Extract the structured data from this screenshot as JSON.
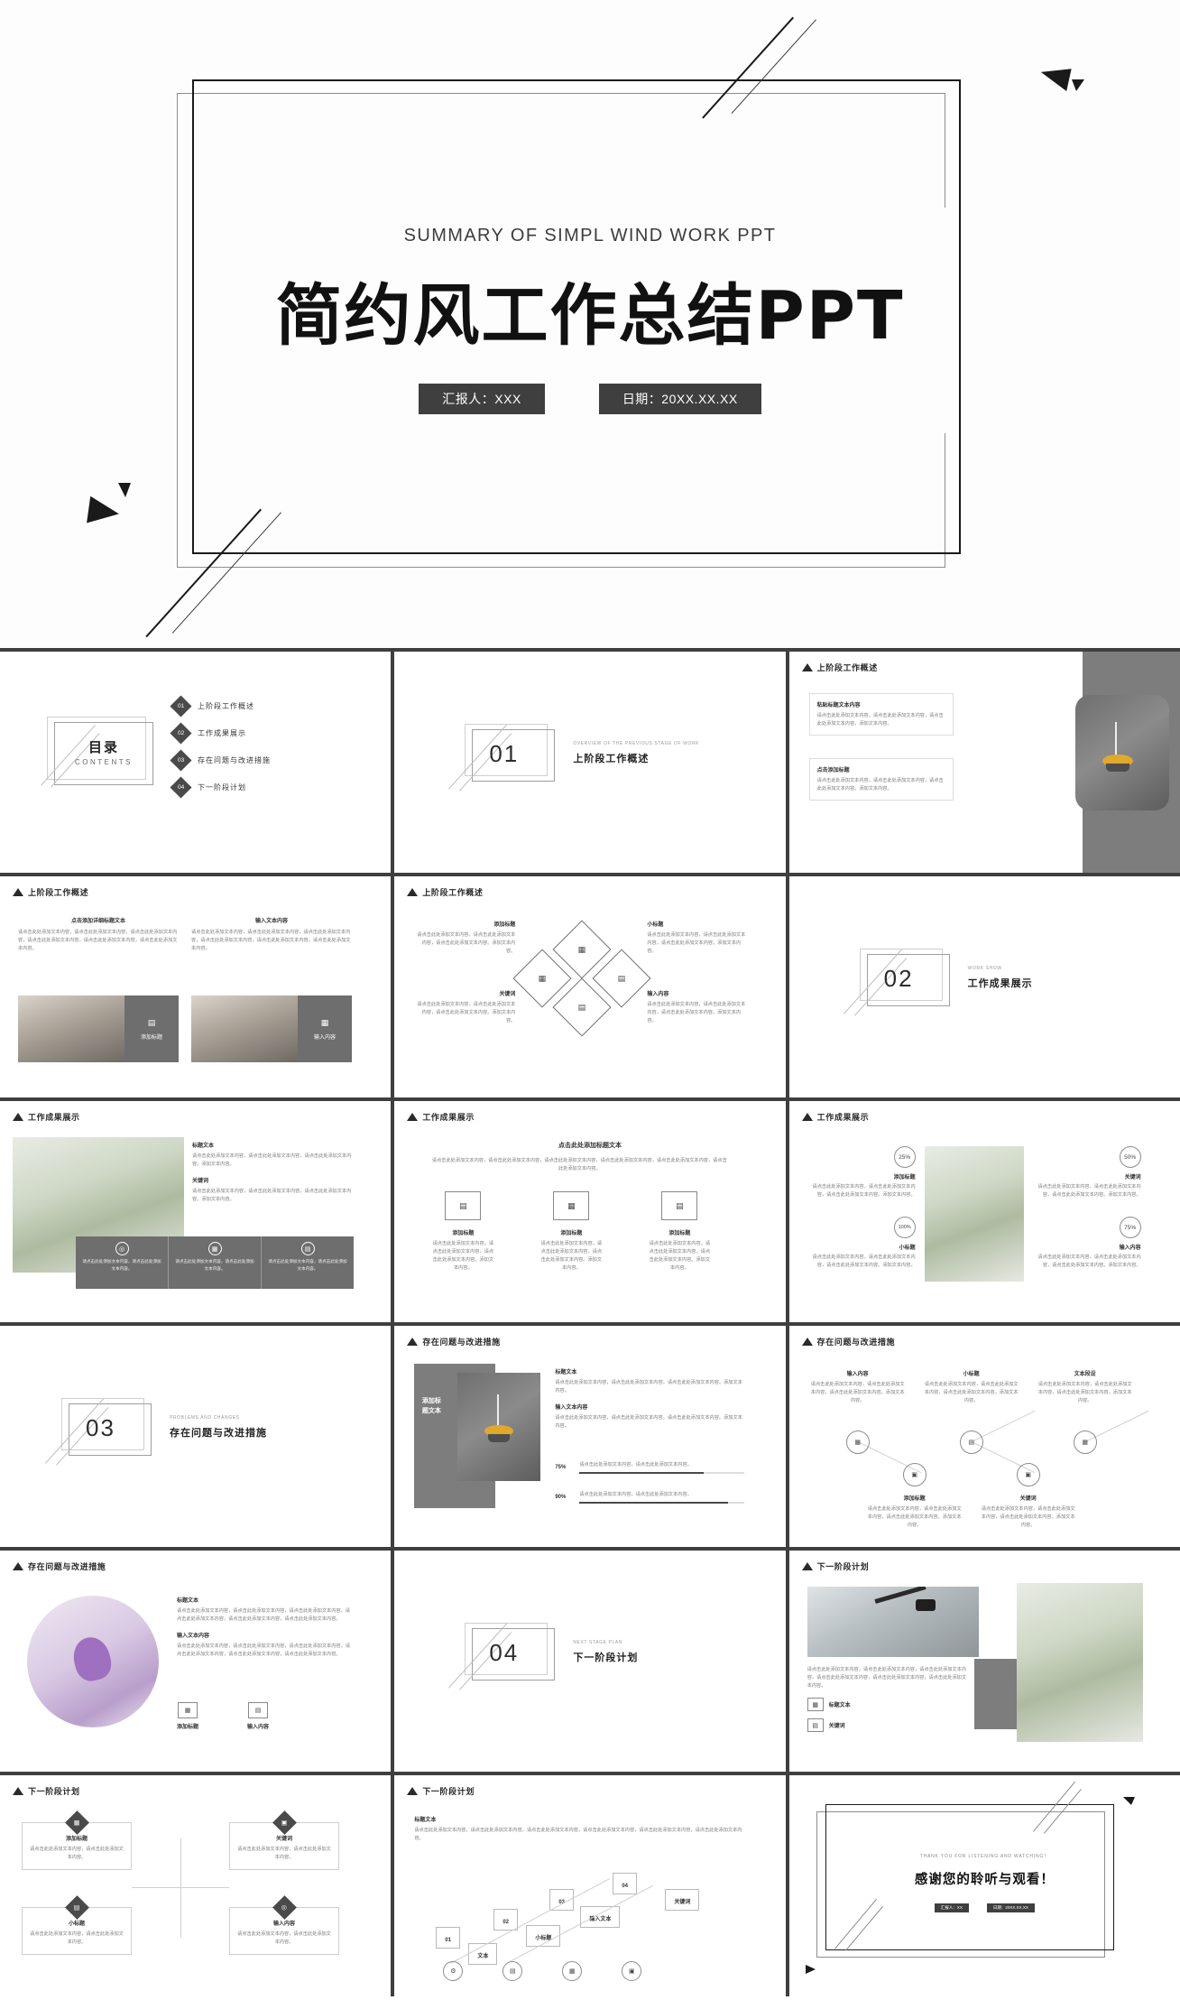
{
  "cover": {
    "subtitle": "SUMMARY OF SIMPL WIND WORK PPT",
    "title": "简约风工作总结PPT",
    "badge_presenter": "汇报人：XXX",
    "badge_date": "日期：20XX.XX.XX"
  },
  "common": {
    "body_text": "请点击此处添加文本内容，请点击此处添加文本内容，请点击此处添加文本内容。添加文本内容。",
    "body_text_short": "请点击此处添加文本内容，请点击此处添加文本内容。",
    "body_text_long": "请点击此处添加文本内容，请点击此处添加文本内容，请点击此处添加文本内容，请点击此处添加文本内容，请点击此处添加文本内容，请点击此处添加文本内容。",
    "add_title": "添加标题",
    "input_content": "输入内容",
    "keyword": "关键词",
    "sub_title": "小标题",
    "title_text": "标题文本",
    "input_text_content": "输入文本内容",
    "text_seg": "文本段设",
    "add_title_text": "添加标题文本",
    "detail_title": "点击添加详细标题文本",
    "input_text": "输入文本内容"
  },
  "sections": {
    "s1": "上阶段工作概述",
    "s2": "工作成果展示",
    "s3": "存在问题与改进措施",
    "s4": "下一阶段计划"
  },
  "slides": [
    {
      "id": "contents",
      "name": "table-of-contents",
      "frame_cn": "目录",
      "frame_en": "CONTENTS",
      "items": [
        {
          "num": "01",
          "label": "上阶段工作概述"
        },
        {
          "num": "02",
          "label": "工作成果展示"
        },
        {
          "num": "03",
          "label": "存在问题与改进措施"
        },
        {
          "num": "04",
          "label": "下一阶段计划"
        }
      ]
    },
    {
      "id": "divider1",
      "name": "section-divider-01",
      "num": "01",
      "en": "OVERVIEW OF THE PREVIOUS STAGE OF WORK",
      "cn": "上阶段工作概述"
    },
    {
      "id": "s1a",
      "name": "overview-two-cards",
      "header": "上阶段工作概述",
      "card1_title": "粘贴标题文本内容",
      "card2_title": "点击添加标题"
    },
    {
      "id": "s1b",
      "name": "overview-two-photos",
      "header": "上阶段工作概述",
      "left_title": "点击添加详细标题文本",
      "right_title": "输入文本内容",
      "tag1": "添加标题",
      "tag2": "输入内容"
    },
    {
      "id": "s1c",
      "name": "overview-diamond-grid",
      "header": "上阶段工作概述",
      "labels": [
        "添加标题",
        "小标题",
        "关键词",
        "输入内容"
      ]
    },
    {
      "id": "divider2",
      "name": "section-divider-02",
      "num": "02",
      "en": "WORK SHOW",
      "cn": "工作成果展示"
    },
    {
      "id": "s2a",
      "name": "results-photo-left",
      "header": "工作成果展示",
      "title": "标题文本",
      "sub": "关键词",
      "cards": 3
    },
    {
      "id": "s2b",
      "name": "results-three-icons",
      "header": "工作成果展示",
      "title": "点击此处添加标题文本",
      "labels": [
        "添加标题",
        "添加标题",
        "添加标题"
      ]
    },
    {
      "id": "s2c",
      "name": "results-percent-circles",
      "header": "工作成果展示",
      "items": [
        {
          "pct": "25%",
          "label": "添加标题"
        },
        {
          "pct": "50%",
          "label": "关键词"
        },
        {
          "pct": "100%",
          "label": "小标题"
        },
        {
          "pct": "75%",
          "label": "输入内容"
        }
      ]
    },
    {
      "id": "divider3",
      "name": "section-divider-03",
      "num": "03",
      "en": "PROBLEMS AND CHANGES",
      "cn": "存在问题与改进措施"
    },
    {
      "id": "s3a",
      "name": "problems-photo-bars",
      "header": "存在问题与改进措施",
      "block_text": "添加标题文本",
      "title": "标题文本",
      "sub": "输入文本内容",
      "bars": [
        {
          "pct": "75%"
        },
        {
          "pct": "90%"
        }
      ]
    },
    {
      "id": "s3b",
      "name": "problems-icon-network",
      "header": "存在问题与改进措施",
      "top_labels": [
        "输入内容",
        "小标题",
        "文本段设"
      ],
      "bottom_labels": [
        "添加标题",
        "关键词"
      ]
    },
    {
      "id": "s3c",
      "name": "problems-round-photo",
      "header": "存在问题与改进措施",
      "title": "标题文本",
      "sub": "输入文本内容",
      "tag1": "添加标题",
      "tag2": "输入内容"
    },
    {
      "id": "divider4",
      "name": "section-divider-04",
      "num": "04",
      "en": "NEXT STAGE PLAN",
      "cn": "下一阶段计划"
    },
    {
      "id": "s4a",
      "name": "plan-two-photos",
      "header": "下一阶段计划",
      "title": "标题文本",
      "sub": "关键词"
    },
    {
      "id": "s4b",
      "name": "plan-four-boxes",
      "header": "下一阶段计划",
      "boxes": [
        "添加标题",
        "关键词",
        "小标题",
        "输入内容"
      ]
    },
    {
      "id": "s4c",
      "name": "plan-timeline",
      "header": "下一阶段计划",
      "title": "标题文本",
      "steps": [
        {
          "num": "01",
          "label": "文本"
        },
        {
          "num": "02",
          "label": "小标题"
        },
        {
          "num": "03",
          "label": "输入文本"
        },
        {
          "num": "04",
          "label": "关键词"
        }
      ]
    },
    {
      "id": "thanks",
      "name": "thank-you",
      "en": "THANK YOU FOR LISTENING AND WATCHING！",
      "cn": "感谢您的聆听与观看！",
      "badge1": "汇报人：XX",
      "badge2": "日期：20XX.XX.XX"
    }
  ]
}
